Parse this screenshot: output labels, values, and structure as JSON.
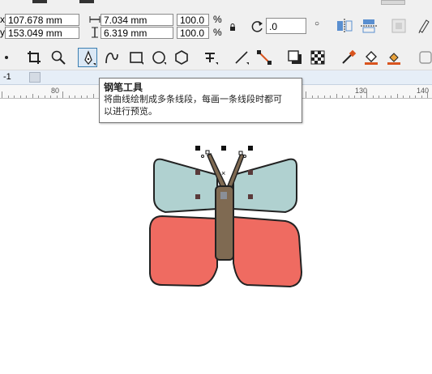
{
  "property_bar": {
    "x_prefix": "x:",
    "x_value": "107.678 mm",
    "y_prefix": "y:",
    "y_value": "153.049 mm",
    "width_value": "7.034 mm",
    "height_value": "6.319 mm",
    "scale_x": "100.0",
    "scale_y": "100.0",
    "percent_symbol": "%",
    "rotation_value": ".0",
    "degree_symbol": "○"
  },
  "tabstrip": {
    "page_label": "-1"
  },
  "ruler": {
    "labels": [
      "80",
      "130",
      "140"
    ]
  },
  "tooltip": {
    "title": "钢笔工具",
    "line1": "将曲线绘制成多条线段，每画一条线段时都可",
    "line2": "以进行预览。"
  },
  "colors": {
    "wing_upper": "#b0d1d0",
    "wing_lower": "#ef6b61",
    "body": "#7f6a52",
    "outline": "#222222",
    "node": "#5a3a3a",
    "tool_highlight": "#dbe8f5"
  }
}
